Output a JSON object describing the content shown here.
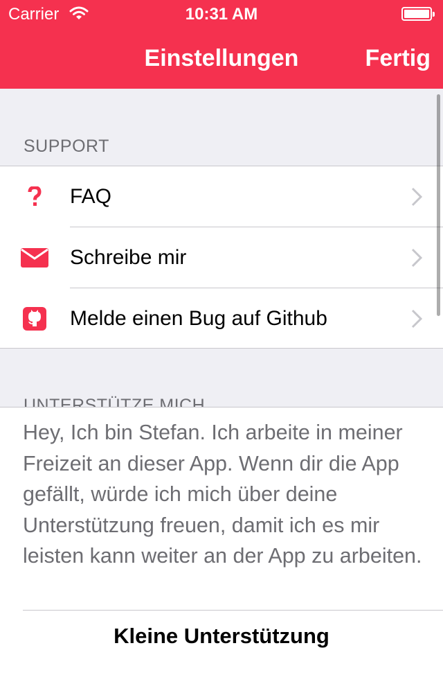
{
  "status_bar": {
    "carrier": "Carrier",
    "time": "10:31 AM",
    "battery_level": 1.0
  },
  "nav": {
    "title": "Einstellungen",
    "done": "Fertig"
  },
  "colors": {
    "accent": "#f5314f",
    "background": "#efeff4",
    "secondary_text": "#6d6d72",
    "separator": "#c8c7cc",
    "chevron": "#c7c7cc"
  },
  "sections": {
    "support": {
      "header": "SUPPORT",
      "items": [
        {
          "label": "FAQ",
          "icon": "question-icon"
        },
        {
          "label": "Schreibe mir",
          "icon": "envelope-icon"
        },
        {
          "label": "Melde einen Bug auf Github",
          "icon": "github-icon"
        }
      ]
    },
    "support_me": {
      "header": "UNTERSTÜTZE MICH",
      "text": "Hey, Ich bin Stefan. Ich arbeite in meiner Freizeit an dieser App. Wenn dir die App gefällt, würde ich mich über deine Unterstützung freuen, damit ich es mir leisten kann weiter an der App zu arbeiten.",
      "option_label": "Kleine Unterstützung"
    }
  }
}
